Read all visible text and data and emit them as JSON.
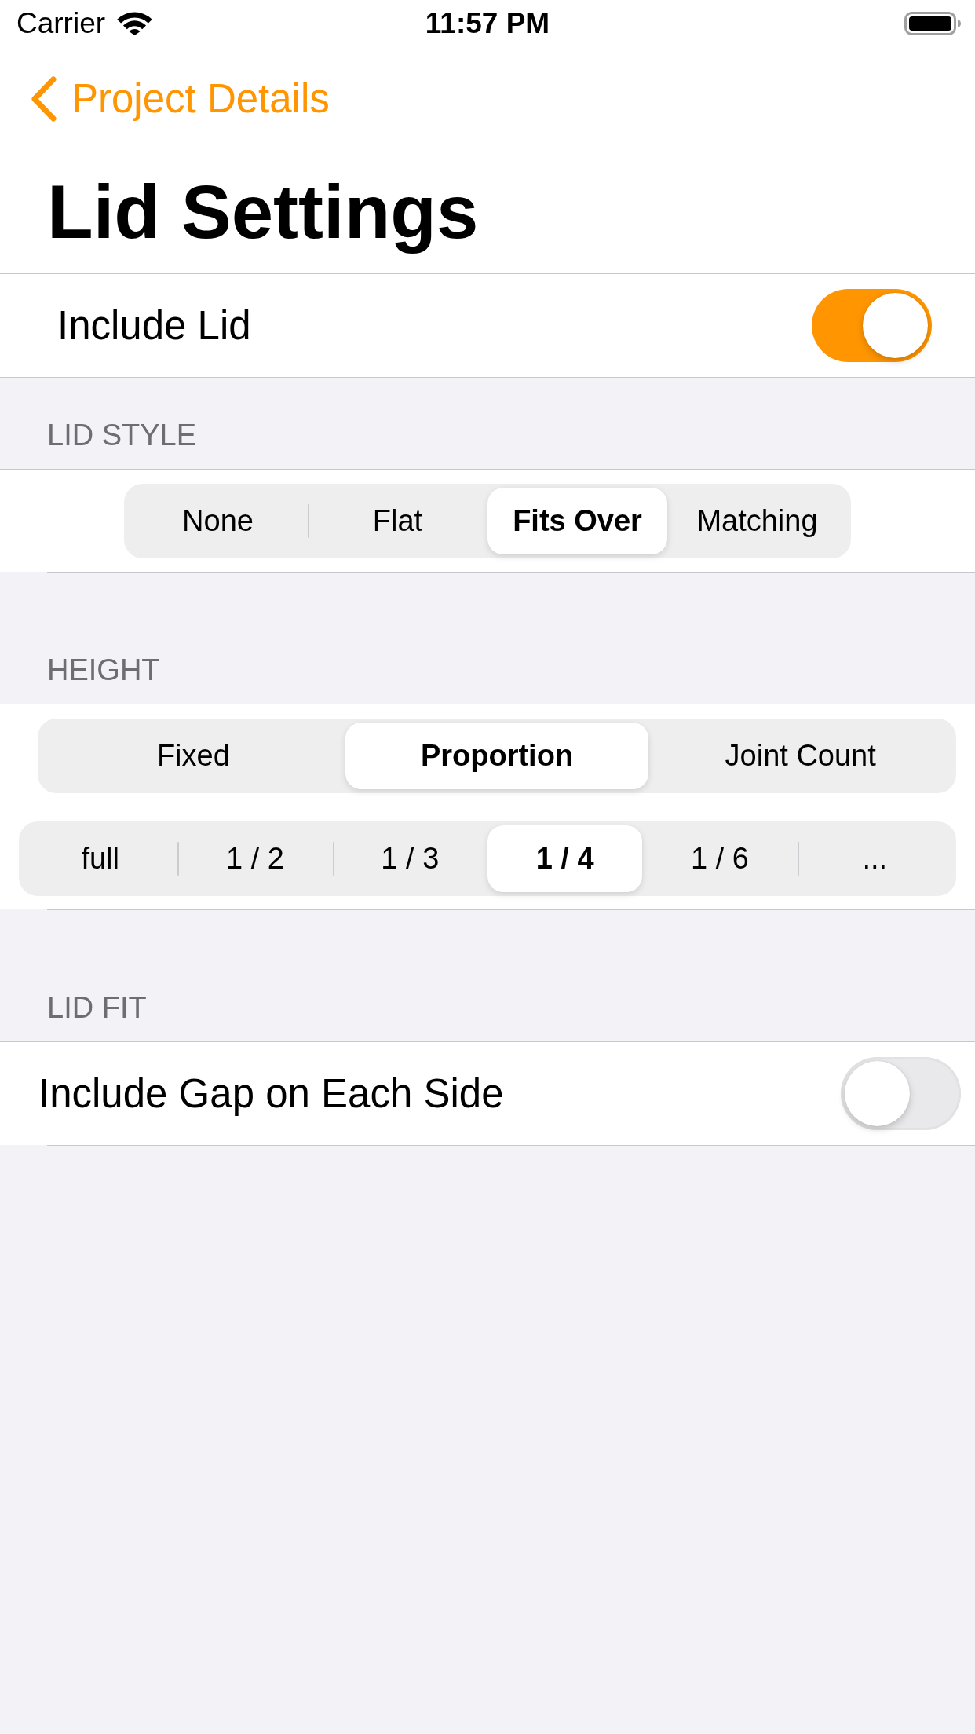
{
  "status_bar": {
    "carrier": "Carrier",
    "time": "11:57 PM"
  },
  "nav_bar": {
    "back_label": "Project Details",
    "title": "Lid Settings"
  },
  "include_lid": {
    "label": "Include Lid",
    "on": true
  },
  "sections": [
    {
      "header": "LID STYLE",
      "rows": [
        {
          "kind": "segmented",
          "segments": [
            {
              "label": "None",
              "selected": false
            },
            {
              "label": "Flat",
              "selected": false
            },
            {
              "label": "Fits Over",
              "selected": true
            },
            {
              "label": "Matching",
              "selected": false
            }
          ]
        }
      ]
    },
    {
      "header": "HEIGHT",
      "rows": [
        {
          "kind": "segmented",
          "segments": [
            {
              "label": "Fixed",
              "selected": false
            },
            {
              "label": "Proportion",
              "selected": true
            },
            {
              "label": "Joint Count",
              "selected": false
            }
          ]
        },
        {
          "kind": "segmented",
          "segments": [
            {
              "label": "full",
              "selected": false
            },
            {
              "label": "1 / 2",
              "selected": false
            },
            {
              "label": "1 / 3",
              "selected": false
            },
            {
              "label": "1 / 4",
              "selected": true
            },
            {
              "label": "1 / 6",
              "selected": false
            },
            {
              "label": "...",
              "selected": false
            }
          ]
        }
      ]
    },
    {
      "header": "LID FIT",
      "rows": [
        {
          "kind": "toggle",
          "label": "Include Gap on Each Side",
          "on": false
        }
      ]
    }
  ]
}
